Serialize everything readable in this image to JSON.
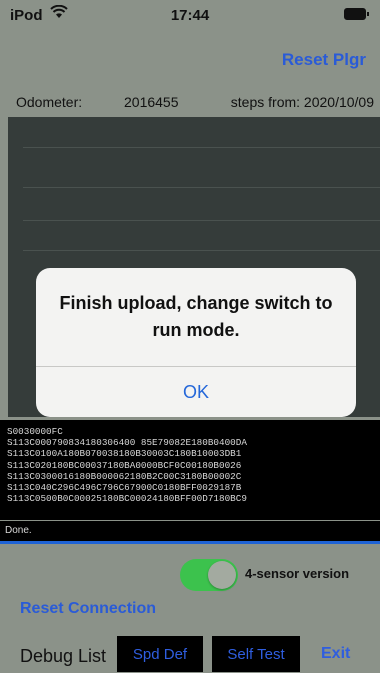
{
  "status_bar": {
    "carrier": "iPod",
    "time": "17:44"
  },
  "header": {
    "reset_plgr": "Reset Plgr"
  },
  "info": {
    "odometer_label": "Odometer:",
    "odometer_value": "2016455",
    "steps_from": "steps from: 2020/10/09"
  },
  "log": {
    "lines": [
      "S0030000FC",
      "S113C000790834180306400 85E79082E180B0400DA",
      "S113C0100A180B070038180B30003C180B10003DB1",
      "S113C020180BC00037180BA0000BCF0C00180B0026",
      "S113C0300016180B000062180B2C00C3180B00002C",
      "S113C040C296C496C796C67900C0180BFF0029187B",
      "S113C0500B0C00025180BC00024180BFF00D7180BC9"
    ],
    "status": "Done."
  },
  "controls": {
    "toggle_label": "4-sensor version",
    "toggle_on": true,
    "reset_connection": "Reset Connection",
    "debug_list": "Debug List",
    "spd_def": "Spd Def",
    "self_test": "Self Test",
    "exit": "Exit"
  },
  "alert": {
    "message": "Finish upload, change switch to run mode.",
    "ok": "OK"
  },
  "colors": {
    "accent": "#2a5bd7",
    "toggle_on": "#3cc24d",
    "background": "#8b9289"
  }
}
